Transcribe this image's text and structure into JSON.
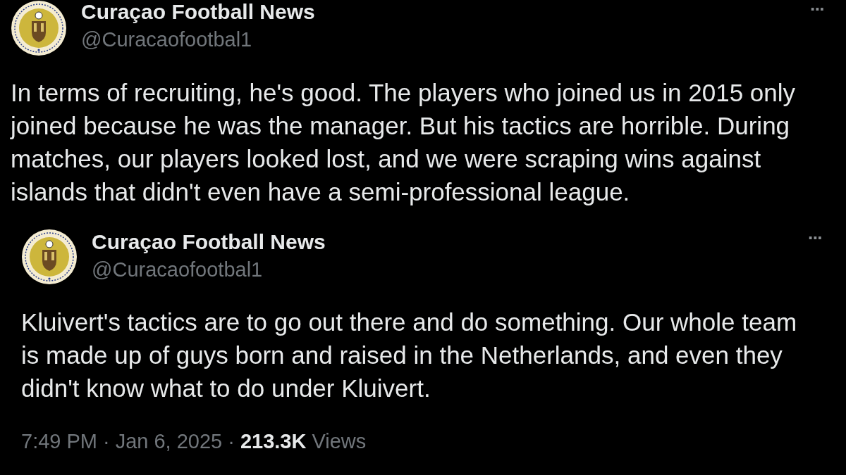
{
  "tweet": {
    "author": {
      "name": "Curaçao Football News",
      "handle": "@Curacaofootbal1"
    },
    "more": "···",
    "text": "In terms of recruiting, he's good. The players who joined us in 2015 only joined because he was the manager. But his tactics are horrible. During matches, our players looked lost, and we were scraping wins against islands that didn't even have a semi-professional league."
  },
  "quoted_tweet": {
    "author": {
      "name": "Curaçao Football News",
      "handle": "@Curacaofootbal1"
    },
    "more": "···",
    "text": "Kluivert's tactics are to go out there and do something. Our whole team is made up of guys born and raised in the Netherlands, and even they didn't know what to do under Kluivert."
  },
  "footer": {
    "time": "7:49 PM",
    "separator_1": "·",
    "date": "Jan 6, 2025",
    "separator_2": "·",
    "views_count": "213.3K",
    "views_label": "Views"
  }
}
